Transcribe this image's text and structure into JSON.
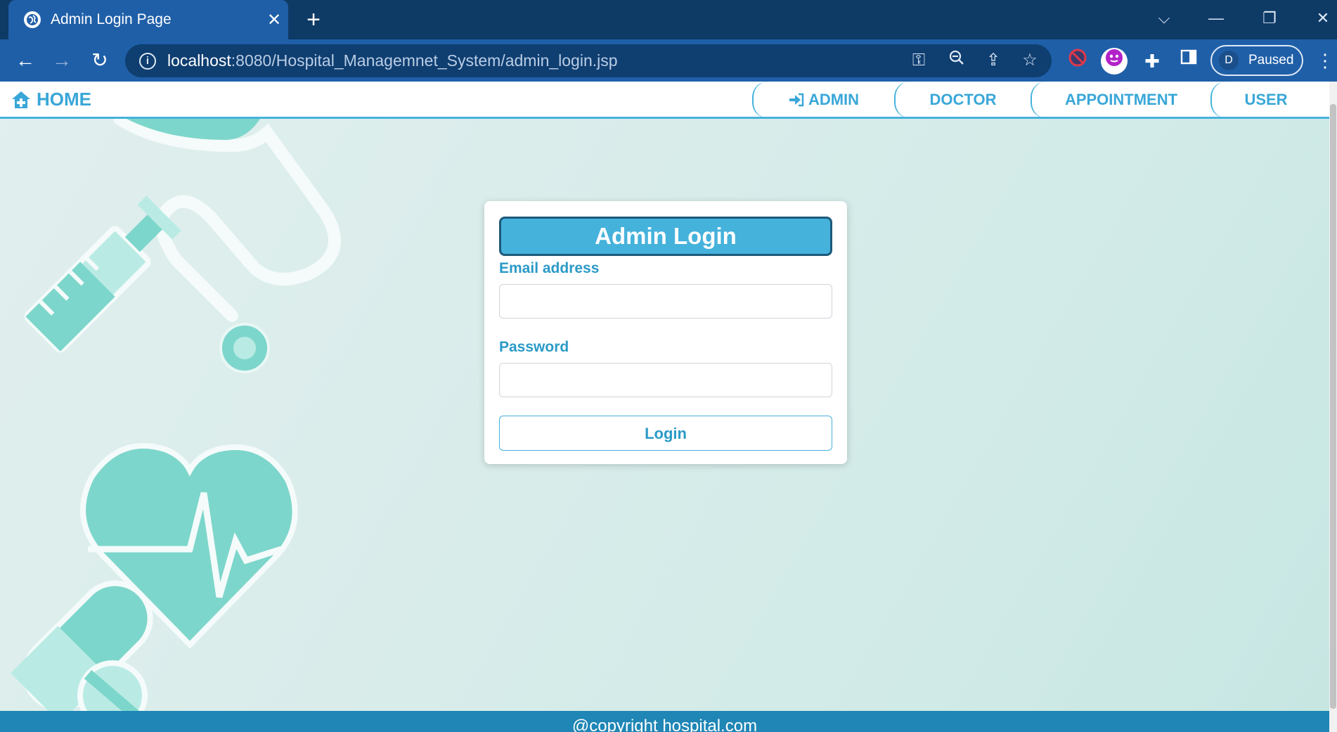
{
  "browser": {
    "tab": {
      "title": "Admin Login Page",
      "favicon": "globe-icon"
    },
    "url": {
      "host": "localhost",
      "path": ":8080/Hospital_Managemnet_System/admin_login.jsp"
    },
    "profile": {
      "initial": "D",
      "status": "Paused"
    }
  },
  "nav": {
    "brand": "HOME",
    "links": [
      {
        "label": "ADMIN",
        "icon": "sign-in-icon"
      },
      {
        "label": "DOCTOR"
      },
      {
        "label": "APPOINTMENT"
      },
      {
        "label": "USER"
      }
    ]
  },
  "login": {
    "title": "Admin Login",
    "email_label": "Email address",
    "email_value": "",
    "password_label": "Password",
    "password_value": "",
    "button": "Login"
  },
  "footer": {
    "text": "@copyright hospital.com"
  },
  "colors": {
    "accent": "#45b2dc",
    "footer": "#1f86b6",
    "decor": "#7dd6cb",
    "chrome": "#1f5fa8"
  }
}
